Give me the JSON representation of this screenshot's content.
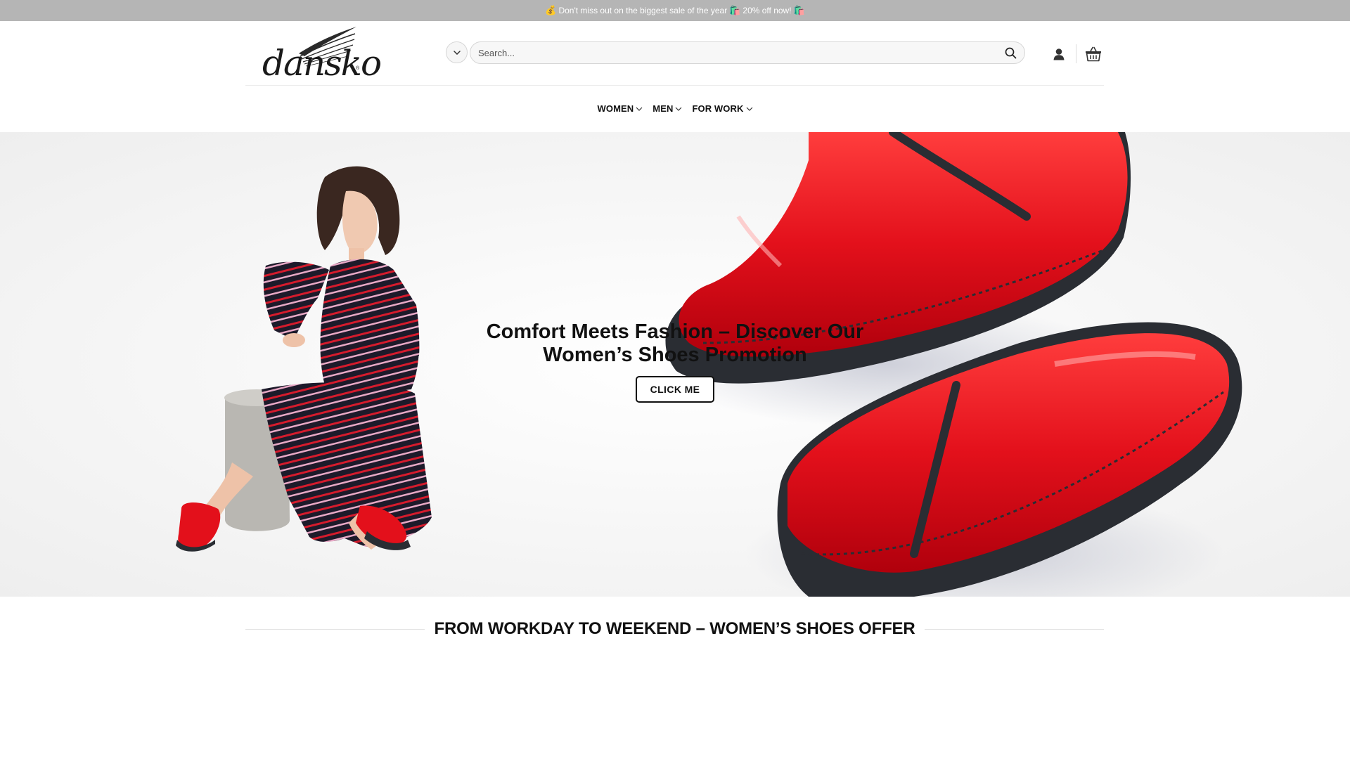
{
  "announcement": {
    "text_start": "Don't miss out on the biggest sale of the year",
    "text_end": "20% off now!",
    "icons": [
      "money-bag-icon",
      "shopping-bags-icon",
      "shopping-bags-icon"
    ]
  },
  "header": {
    "logo_text": "dansko",
    "logo_mark": "®",
    "search": {
      "placeholder": "Search...",
      "value": ""
    },
    "icons": {
      "category_toggle": "chevron-down-icon",
      "search": "search-icon",
      "account": "user-icon",
      "cart": "basket-icon"
    }
  },
  "nav": {
    "items": [
      {
        "label": "WOMEN"
      },
      {
        "label": "MEN"
      },
      {
        "label": "FOR WORK"
      }
    ]
  },
  "hero": {
    "title_line1": "Comfort Meets Fashion – Discover Our",
    "title_line2": "Women’s Shoes Promotion",
    "cta_label": "CLICK ME",
    "colors": {
      "clog_red": "#e3101b",
      "sole": "#2a2d33",
      "dress_dark": "#1d1a2a",
      "stripe_red": "#d51b2c",
      "stripe_pink": "#e8a9c6"
    }
  },
  "section": {
    "title": "FROM WORKDAY TO WEEKEND – WOMEN’S SHOES OFFER"
  }
}
